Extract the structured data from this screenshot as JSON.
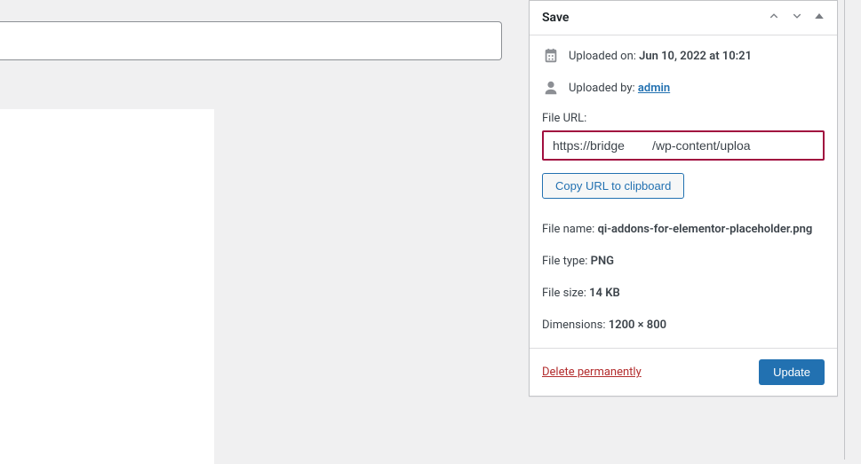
{
  "main": {
    "title_value": ""
  },
  "save_panel": {
    "title": "Save",
    "uploaded_on": {
      "label": "Uploaded on:",
      "value": "Jun 10, 2022 at 10:21"
    },
    "uploaded_by": {
      "label": "Uploaded by:",
      "user": "admin"
    },
    "file_url": {
      "label": "File URL:",
      "value": "https://bridge        /wp-content/uploa"
    },
    "copy_button": "Copy URL to clipboard",
    "file_name": {
      "label": "File name:",
      "value": "qi-addons-for-elementor-placeholder.png"
    },
    "file_type": {
      "label": "File type:",
      "value": "PNG"
    },
    "file_size": {
      "label": "File size:",
      "value": "14 KB"
    },
    "dimensions": {
      "label": "Dimensions:",
      "value": "1200 × 800"
    },
    "delete_label": "Delete permanently",
    "update_label": "Update"
  }
}
